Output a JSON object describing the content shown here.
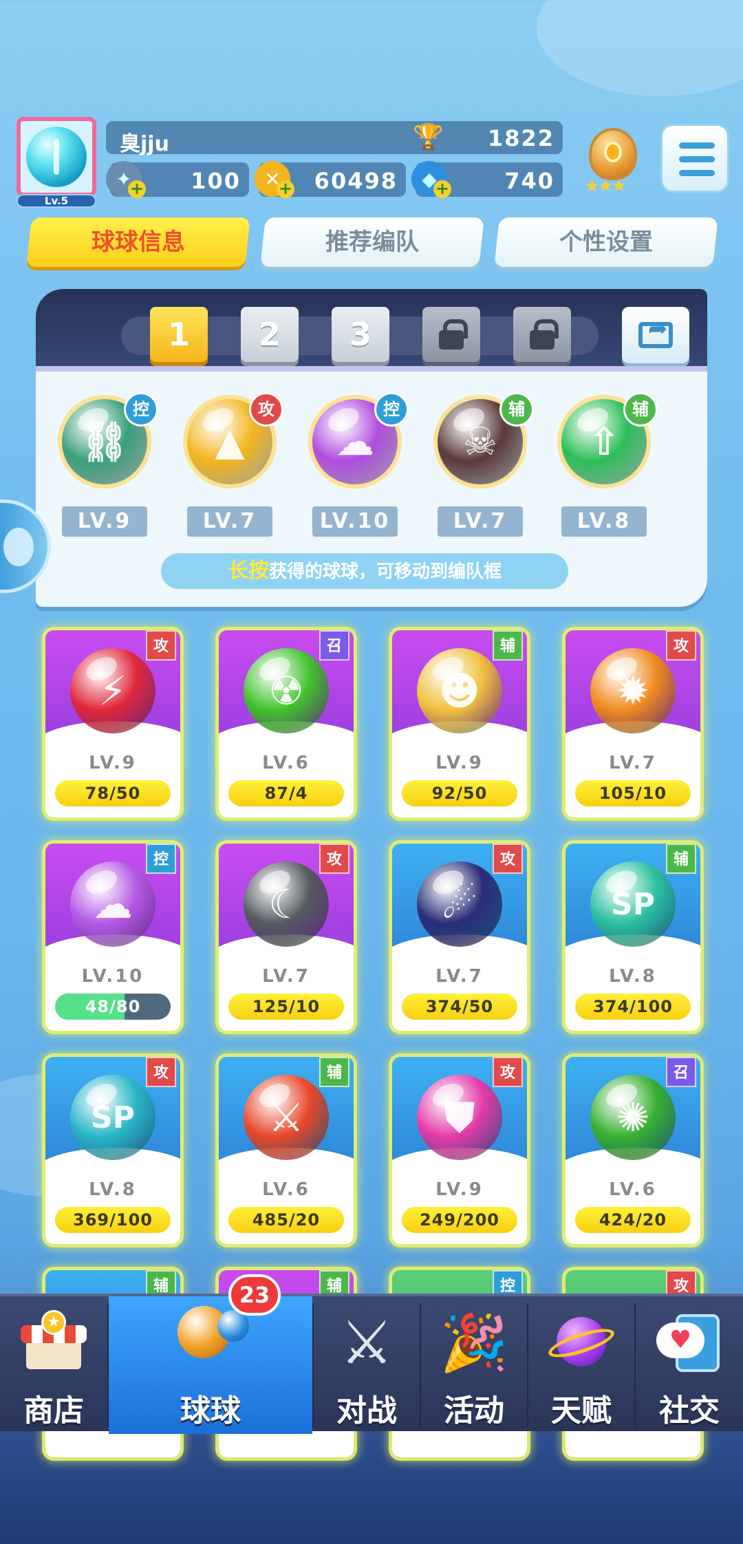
{
  "player": {
    "name": "臭jju",
    "level_badge": "Lv.5",
    "trophies": "1822",
    "stamina": "100",
    "coins": "60498",
    "gems": "740"
  },
  "tabs": [
    {
      "label": "球球信息",
      "active": true
    },
    {
      "label": "推荐编队",
      "active": false
    },
    {
      "label": "个性设置",
      "active": false
    }
  ],
  "team": {
    "slots": [
      "1",
      "2",
      "3",
      "lock",
      "lock"
    ],
    "active_slot": "1",
    "balls": [
      {
        "name": "chain",
        "role": "控",
        "level": "LV.9",
        "color": "#3aa07a"
      },
      {
        "name": "spark",
        "role": "攻",
        "level": "LV.7",
        "color": "#f2b51e"
      },
      {
        "name": "cloud",
        "role": "控",
        "level": "LV.10",
        "color": "#b04ce0"
      },
      {
        "name": "skull",
        "role": "辅",
        "level": "LV.7",
        "color": "#5a3a3a"
      },
      {
        "name": "arrow-up",
        "role": "辅",
        "level": "LV.8",
        "color": "#2cbe5a"
      }
    ],
    "hint_highlight": "长按",
    "hint_text": "获得的球球，可移动到编队框"
  },
  "balls": [
    {
      "role": "攻",
      "level": "LV.9",
      "progress": "78/50",
      "bg": "purple",
      "orb": "#e0283c",
      "icon": "lightning-icon"
    },
    {
      "role": "召",
      "level": "LV.6",
      "progress": "87/4",
      "bg": "purple",
      "orb": "#42c22e",
      "icon": "radiation-icon"
    },
    {
      "role": "辅",
      "level": "LV.9",
      "progress": "92/50",
      "bg": "purple",
      "orb": "#f0c040",
      "icon": "pumpkin-icon"
    },
    {
      "role": "攻",
      "level": "LV.7",
      "progress": "105/10",
      "bg": "purple",
      "orb": "#f08a20",
      "icon": "sun-wand-icon"
    },
    {
      "role": "控",
      "level": "LV.10",
      "progress": "48/80",
      "bg": "purple",
      "orb": "#b45ae6",
      "icon": "cloud-icon",
      "fill": 0.6
    },
    {
      "role": "攻",
      "level": "LV.7",
      "progress": "125/10",
      "bg": "purple",
      "orb": "#555a60",
      "icon": "scythe-icon"
    },
    {
      "role": "攻",
      "level": "LV.7",
      "progress": "374/50",
      "bg": "blue",
      "orb": "#2a2e78",
      "icon": "comet-icon"
    },
    {
      "role": "辅",
      "level": "LV.8",
      "progress": "374/100",
      "bg": "blue",
      "orb": "#2cc0a0",
      "icon": "sp-hand-icon"
    },
    {
      "role": "攻",
      "level": "LV.8",
      "progress": "369/100",
      "bg": "blue",
      "orb": "#2ab6c8",
      "icon": "sp-sword-icon"
    },
    {
      "role": "辅",
      "level": "LV.6",
      "progress": "485/20",
      "bg": "blue",
      "orb": "#e8482a",
      "icon": "swords-up-icon"
    },
    {
      "role": "攻",
      "level": "LV.9",
      "progress": "249/200",
      "bg": "blue",
      "orb": "#e43aa8",
      "icon": "shield-break-icon"
    },
    {
      "role": "召",
      "level": "LV.6",
      "progress": "424/20",
      "bg": "blue",
      "orb": "#38b030",
      "icon": "thorn-icon"
    },
    {
      "role": "辅",
      "bg": "blue"
    },
    {
      "role": "辅",
      "bg": "purple"
    },
    {
      "role": "控",
      "bg": "green"
    },
    {
      "role": "攻",
      "bg": "green"
    }
  ],
  "nav": [
    {
      "label": "商店",
      "icon": "shop-icon",
      "active": false
    },
    {
      "label": "球球",
      "icon": "balls-icon",
      "active": true,
      "badge": "23"
    },
    {
      "label": "对战",
      "icon": "crossed-swords-icon",
      "active": false
    },
    {
      "label": "活动",
      "icon": "party-popper-icon",
      "active": false
    },
    {
      "label": "天赋",
      "icon": "planet-icon",
      "active": false
    },
    {
      "label": "社交",
      "icon": "chat-heart-icon",
      "active": false
    }
  ]
}
